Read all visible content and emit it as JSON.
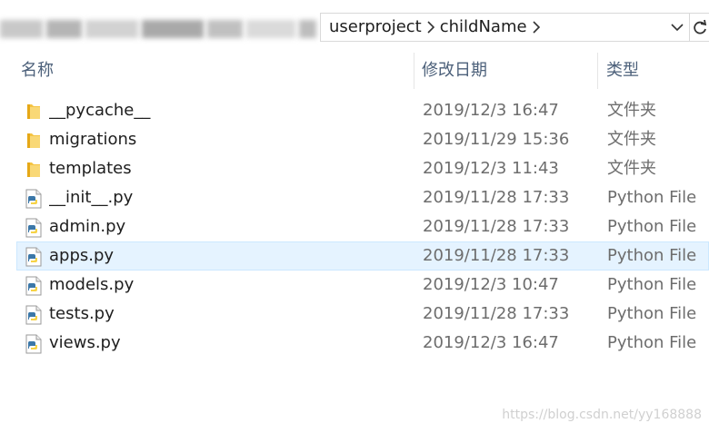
{
  "address_bar": {
    "breadcrumbs": [
      "userproject",
      "childName"
    ],
    "separator_icon": "chevron-right-icon",
    "dropdown_icon": "chevron-down-icon",
    "refresh_icon": "refresh-icon"
  },
  "columns": {
    "name": "名称",
    "date_modified": "修改日期",
    "type": "类型"
  },
  "files": [
    {
      "name": "__pycache__",
      "date": "2019/12/3 16:47",
      "type": "文件夹",
      "icon": "folder-icon"
    },
    {
      "name": "migrations",
      "date": "2019/11/29 15:36",
      "type": "文件夹",
      "icon": "folder-icon"
    },
    {
      "name": "templates",
      "date": "2019/12/3 11:43",
      "type": "文件夹",
      "icon": "folder-icon"
    },
    {
      "name": "__init__.py",
      "date": "2019/11/28 17:33",
      "type": "Python File",
      "icon": "python-file-icon"
    },
    {
      "name": "admin.py",
      "date": "2019/11/28 17:33",
      "type": "Python File",
      "icon": "python-file-icon"
    },
    {
      "name": "apps.py",
      "date": "2019/11/28 17:33",
      "type": "Python File",
      "icon": "python-file-icon",
      "selected": true
    },
    {
      "name": "models.py",
      "date": "2019/12/3 10:47",
      "type": "Python File",
      "icon": "python-file-icon"
    },
    {
      "name": "tests.py",
      "date": "2019/11/28 17:33",
      "type": "Python File",
      "icon": "python-file-icon"
    },
    {
      "name": "views.py",
      "date": "2019/12/3 16:47",
      "type": "Python File",
      "icon": "python-file-icon"
    }
  ],
  "colors": {
    "selection_bg": "#e5f3ff",
    "selection_border": "#cce8ff",
    "header_text": "#4c607a",
    "folder": "#f5c443",
    "python_blue": "#3b77a8",
    "python_yellow": "#f7d347"
  },
  "watermark": "https://blog.csdn.net/yy168888"
}
